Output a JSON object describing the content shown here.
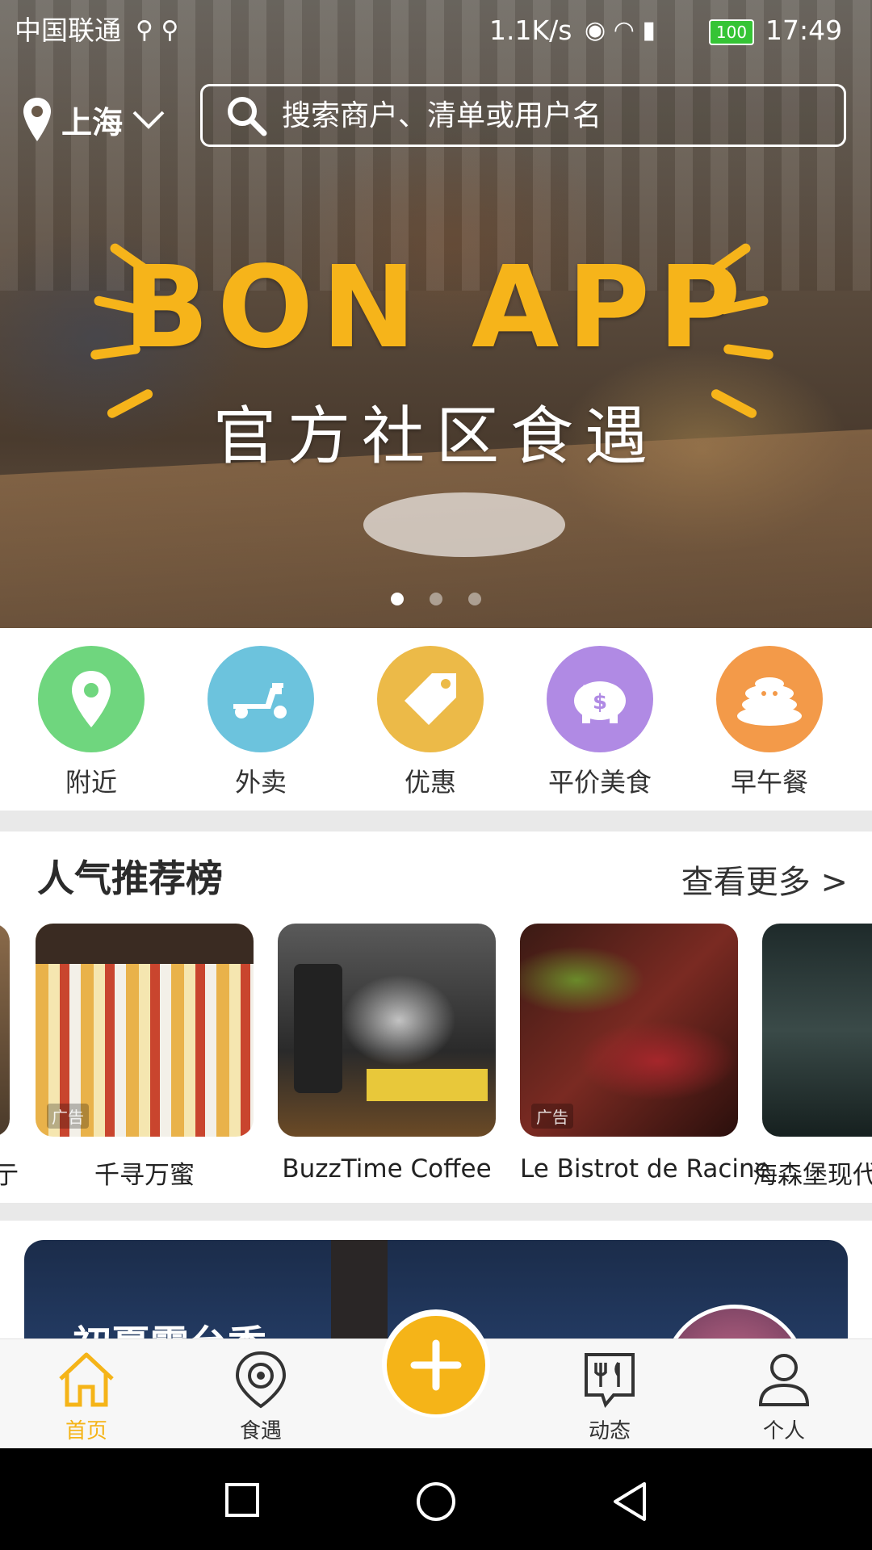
{
  "status_bar": {
    "carrier": "中国联通",
    "speed": "1.1K/s",
    "battery": "100",
    "time": "17:49"
  },
  "location": {
    "city": "上海"
  },
  "search": {
    "placeholder": "搜索商户、清单或用户名"
  },
  "banner": {
    "title": "BON APP",
    "subtitle": "官方社区食遇",
    "dots": 3,
    "active_dot": 0
  },
  "categories": [
    {
      "label": "附近",
      "icon": "map-pin-icon",
      "color": "#6fd67e"
    },
    {
      "label": "外卖",
      "icon": "scooter-icon",
      "color": "#6cc3dd"
    },
    {
      "label": "优惠",
      "icon": "tag-icon",
      "color": "#ecba48"
    },
    {
      "label": "平价美食",
      "icon": "piggy-bank-icon",
      "color": "#b08ae4"
    },
    {
      "label": "早午餐",
      "icon": "pancake-icon",
      "color": "#f39a49"
    }
  ],
  "section": {
    "title": "人气推荐榜",
    "more": "查看更多 >"
  },
  "restaurants": [
    {
      "name": "千寻万蜜",
      "ad": "广告"
    },
    {
      "name": "BuzzTime Coffee",
      "ad": ""
    },
    {
      "name": "Le Bistrot de Racine",
      "ad": "广告"
    },
    {
      "name": "海森堡现代",
      "ad": ""
    }
  ],
  "feature": {
    "text": "初夏露台季"
  },
  "tabbar": [
    {
      "label": "首页",
      "icon": "home-icon",
      "active": true
    },
    {
      "label": "食遇",
      "icon": "location-ring-icon",
      "active": false
    },
    {
      "label": "动态",
      "icon": "fork-knife-icon",
      "active": false
    },
    {
      "label": "个人",
      "icon": "person-icon",
      "active": false
    }
  ],
  "colors": {
    "accent": "#f5b418",
    "text": "#222222"
  }
}
